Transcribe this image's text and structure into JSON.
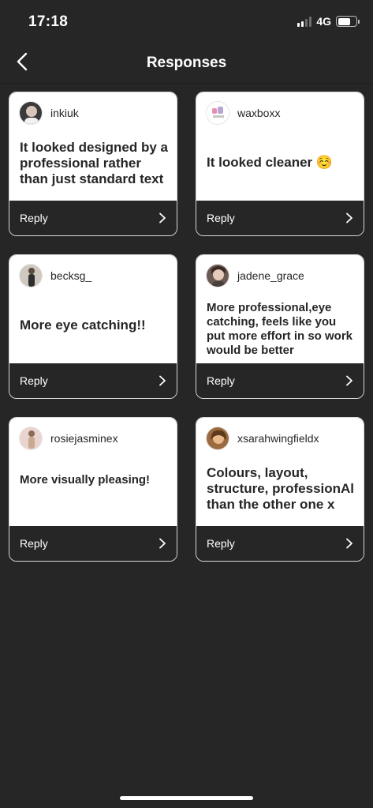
{
  "status": {
    "time": "17:18",
    "network": "4G"
  },
  "nav": {
    "title": "Responses"
  },
  "reply_label": "Reply",
  "responses": [
    {
      "username": "inkiuk",
      "text": "It looked designed by a professional rather than just standard text",
      "avatar": "avatar-1"
    },
    {
      "username": "waxboxx",
      "text": "It looked cleaner ☺️",
      "avatar": "avatar-2"
    },
    {
      "username": "becksg_",
      "text": "More eye catching!!",
      "avatar": "avatar-3"
    },
    {
      "username": "jadene_grace",
      "text": "More professional,eye catching, feels like you put more effort in so work would be better",
      "avatar": "avatar-4"
    },
    {
      "username": "rosiejasminex",
      "text": "More visually pleasing!",
      "avatar": "avatar-5"
    },
    {
      "username": "xsarahwingfieldx",
      "text": "Colours, layout, structure, professionAl than the other one x",
      "avatar": "avatar-6"
    }
  ],
  "colors": {
    "background": "#262626",
    "card_top": "#ffffff",
    "card_border": "#d9d9d9",
    "text_dark": "#262626"
  }
}
